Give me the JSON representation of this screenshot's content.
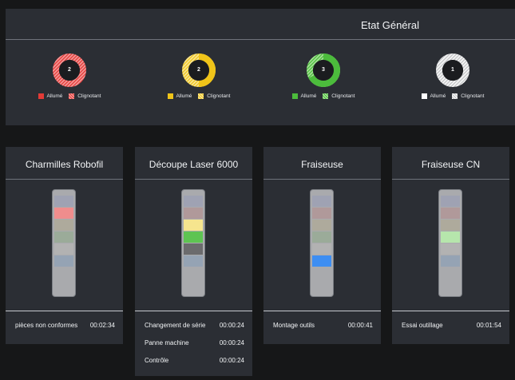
{
  "general": {
    "title": "Etat Général",
    "legend_on": "Allumé",
    "legend_blink": "Clignotant",
    "donuts": [
      {
        "count": "2",
        "color": "#e23a36",
        "light": "#f59a9a",
        "on_fraction": 0.0
      },
      {
        "count": "2",
        "color": "#f0c419",
        "light": "#f7e69a",
        "on_fraction": 0.5
      },
      {
        "count": "3",
        "color": "#4cbc3c",
        "light": "#a8e29a",
        "on_fraction": 0.67
      },
      {
        "count": "1",
        "color": "#ffffff",
        "light": "#c9cacc",
        "on_fraction": 0.0
      }
    ]
  },
  "machines": [
    {
      "name": "Charmilles Robofil",
      "lights": [
        "off",
        "red",
        "off",
        "off",
        "off",
        "off"
      ],
      "events": [
        {
          "label": "pièces non conformes",
          "time": "00:02:34"
        }
      ]
    },
    {
      "name": "Découpe Laser 6000",
      "lights": [
        "off",
        "off",
        "yellow",
        "green",
        "dark",
        "off"
      ],
      "events": [
        {
          "label": "Changement de série",
          "time": "00:00:24"
        },
        {
          "label": "Panne machine",
          "time": "00:00:24"
        },
        {
          "label": "Contrôle",
          "time": "00:00:24"
        }
      ]
    },
    {
      "name": "Fraiseuse",
      "lights": [
        "off",
        "off",
        "off",
        "off",
        "off",
        "blue"
      ],
      "events": [
        {
          "label": "Montage outils",
          "time": "00:00:41"
        }
      ]
    },
    {
      "name": "Fraiseuse CN",
      "lights": [
        "off",
        "off",
        "off",
        "lightgreen",
        "off",
        "off"
      ],
      "events": [
        {
          "label": "Essai outillage",
          "time": "00:01:54"
        }
      ]
    }
  ],
  "colors": {
    "red": "#ef8d8d",
    "yellow": "#f6e58e",
    "green": "#5ec452",
    "lightgreen": "#b6e6ac",
    "dark": "#6b6b6d",
    "blue": "#3d8ef2"
  }
}
